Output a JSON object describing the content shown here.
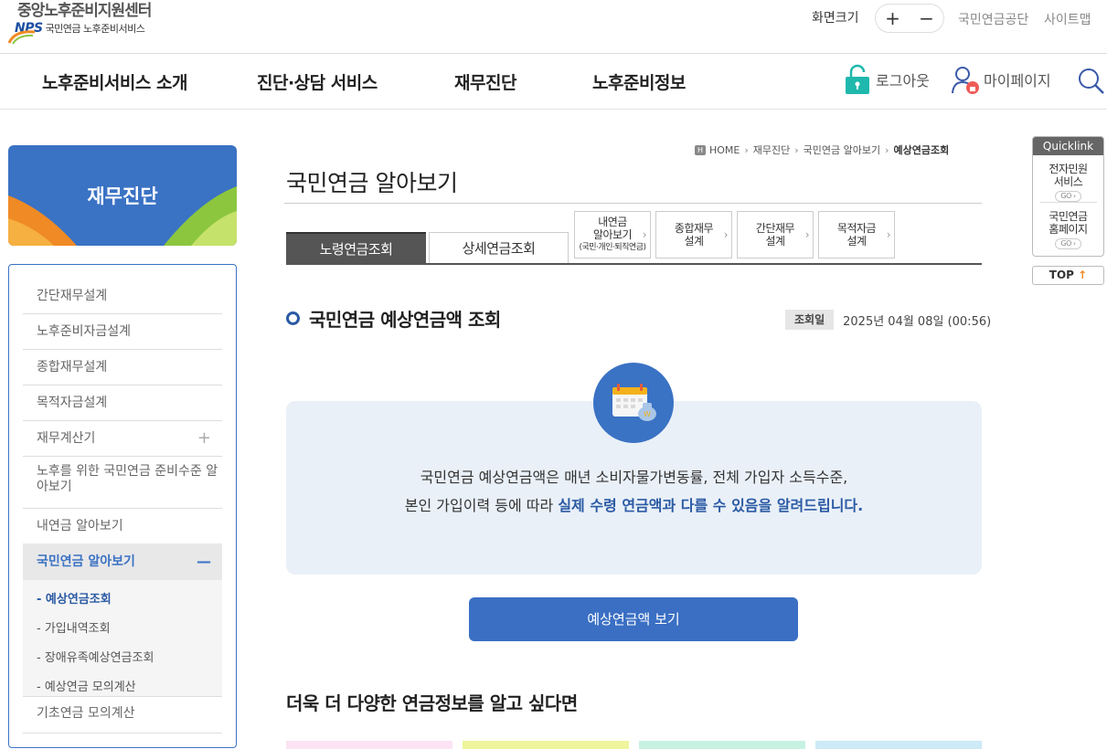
{
  "header": {
    "logo_title": "중앙노후준비지원센터",
    "logo_brand": "NPS",
    "logo_sub": "국민연금 노후준비서비스",
    "fontsize_label": "화면크기",
    "fontsize_plus": "+",
    "fontsize_minus": "−",
    "links": [
      "국민연금공단",
      "사이트맵"
    ]
  },
  "gnb": {
    "items": [
      "노후준비서비스 소개",
      "진단·상담 서비스",
      "재무진단",
      "노후준비정보"
    ],
    "logout": "로그아웃",
    "mypage": "마이페이지"
  },
  "sidebar": {
    "title": "재무진단",
    "items": [
      "간단재무설계",
      "노후준비자금설계",
      "종합재무설계",
      "목적자금설계",
      "재무계산기",
      "노후를 위한 국민연금 준비수준 알아보기",
      "내연금 알아보기"
    ],
    "active": "국민연금 알아보기",
    "sub_items": [
      "- 예상연금조회",
      "- 가입내역조회",
      "- 장애유족예상연금조회",
      "- 예상연금 모의계산"
    ],
    "last_item": "기초연금 모의계산"
  },
  "breadcrumb": [
    "HOME",
    "재무진단",
    "국민연금 알아보기",
    "예상연금조회"
  ],
  "page_title": "국민연금 알아보기",
  "tabs": [
    "노령연금조회",
    "상세연금조회"
  ],
  "subtabs": [
    {
      "line1": "내연금",
      "line2": "알아보기",
      "small": "(국민·개인·퇴직연금)"
    },
    {
      "line1": "종합재무",
      "line2": "설계"
    },
    {
      "line1": "간단재무",
      "line2": "설계"
    },
    {
      "line1": "목적자금",
      "line2": "설계"
    }
  ],
  "section": {
    "title": "국민연금 예상연금액 조회",
    "date_label": "조회일",
    "date_value": "2025년 04월 08일 (00:56)"
  },
  "info": {
    "line1": "국민연금 예상연금액은 매년 소비자물가변동률, 전체 가입자 소득수준,",
    "line2_a": "본인 가입이력 등에 따라 ",
    "line2_b": "실제 수령 연금액과 다를 수 있음을 알려드립니다."
  },
  "main_button": "예상연금액 보기",
  "more_title": "더욱 더 다양한 연금정보를 알고 싶다면",
  "cards": [
    {
      "color": "#fbe3f3"
    },
    {
      "color": "#eef59c"
    },
    {
      "color": "#c7f2e2"
    },
    {
      "color": "#cdeaf7"
    }
  ],
  "quicklink": {
    "head": "Quicklink",
    "items": [
      {
        "line1": "전자민원",
        "line2": "서비스",
        "go": "GO ›"
      },
      {
        "line1": "국민연금",
        "line2": "홈페이지",
        "go": "GO ›"
      }
    ],
    "top": "TOP",
    "top_arrow": "↑"
  },
  "colors": {
    "accent": "#3a72c4",
    "highlight": "#2b5aa4",
    "info_bg": "#e9f0f8"
  }
}
